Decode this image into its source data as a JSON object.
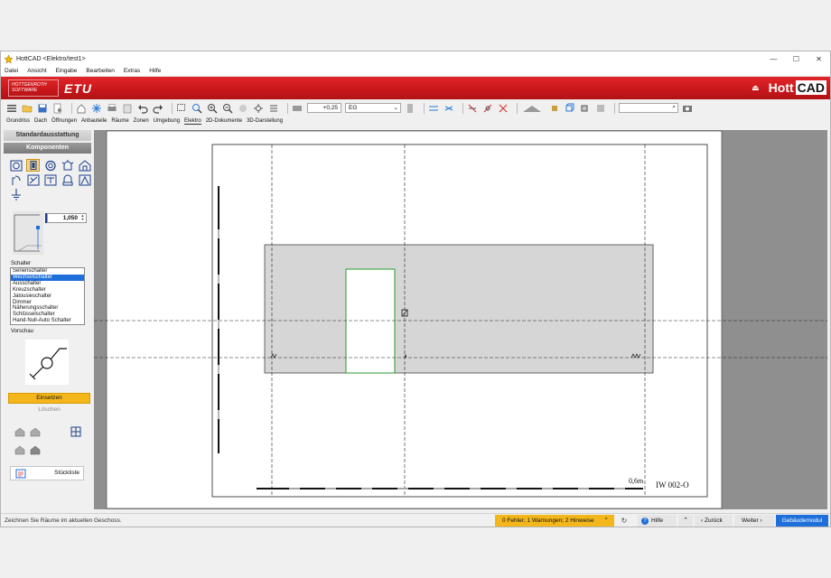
{
  "window": {
    "title": "HottCAD <Elektro/test1>",
    "minimize": "—",
    "maximize": "☐",
    "close": "✕"
  },
  "menu": [
    "Datei",
    "Ansicht",
    "Eingabe",
    "Bearbeiten",
    "Extras",
    "Hilfe"
  ],
  "brand": {
    "logo_line1": "HOTTGENROTH",
    "logo_line2": "SOFTWARE",
    "product": "ETU",
    "app_name_1": "Hott",
    "app_name_2": "CAD"
  },
  "toolbar": {
    "height_value": "+0,25",
    "floor_value": "EG",
    "search_placeholder": ""
  },
  "tabs": [
    "Grundriss",
    "Dach",
    "Öffnungen",
    "Anbauteile",
    "Räume",
    "Zonen",
    "Umgebung",
    "Elektro",
    "2D-Dokumente",
    "3D-Darstellung"
  ],
  "sidebar": {
    "section1": "Standardausstattung",
    "section2": "Komponenten",
    "height_value": "1,050",
    "switch_label": "Schalter",
    "switch_items": [
      "Serienschalter",
      "Wechselschalter",
      "Ausschalter",
      "Kreuzschalter",
      "Jalousieschalter",
      "Dimmer",
      "Näherungsschalter",
      "Schlüsselschalter",
      "Hand-Null-Auto Schalter"
    ],
    "selected_index": 1,
    "preview_label": "Vorschau",
    "insert": "Einsetzen",
    "delete": "Löschen",
    "parts_list": "Stückliste"
  },
  "drawing": {
    "scale_label": "0,6m",
    "view_label": "IW 002-O"
  },
  "status": {
    "text": "Zeichnen Sie Räume im aktuellen Geschoss.",
    "warnings": "0 Fehler; 1 Warnungen; 2 Hinweise",
    "help": "Hilfe",
    "back": "Zurück",
    "next": "Weiter",
    "module": "Gebäudemodul"
  },
  "colors": {
    "brand_red": "#c7161a",
    "accent_orange": "#f3b61b",
    "accent_blue": "#1e6fd9"
  }
}
